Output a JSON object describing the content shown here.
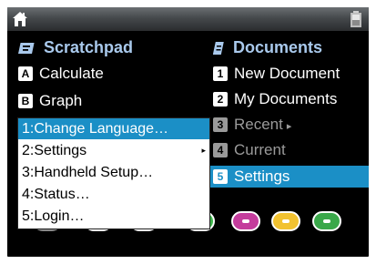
{
  "left_column": {
    "title": "Scratchpad",
    "items": [
      {
        "key": "A",
        "label": "Calculate"
      },
      {
        "key": "B",
        "label": "Graph"
      }
    ]
  },
  "right_column": {
    "title": "Documents",
    "items": [
      {
        "key": "1",
        "label": "New Document"
      },
      {
        "key": "2",
        "label": "My Documents"
      },
      {
        "key": "3",
        "label": "Recent",
        "arrow": "▸"
      },
      {
        "key": "4",
        "label": "Current"
      },
      {
        "key": "5",
        "label": "Settings"
      }
    ]
  },
  "popup_menu": {
    "items": [
      {
        "label": "1:Change Language…"
      },
      {
        "label": "2:Settings",
        "arrow": "▸"
      },
      {
        "label": "3:Handheld Setup…"
      },
      {
        "label": "4:Status…"
      },
      {
        "label": "5:Login…"
      }
    ]
  },
  "colors": {
    "selection": "#1b8fc6",
    "heading": "#a9c9ec",
    "pills": [
      "#555555",
      "#2a8fd0",
      "#2458c8",
      "#3cb54a",
      "#c43c9c",
      "#f2c230",
      "#3aa84a"
    ]
  },
  "icons": {
    "home": "home-icon",
    "battery": "battery-icon",
    "scratchpad": "scratchpad-icon",
    "documents": "documents-icon"
  }
}
